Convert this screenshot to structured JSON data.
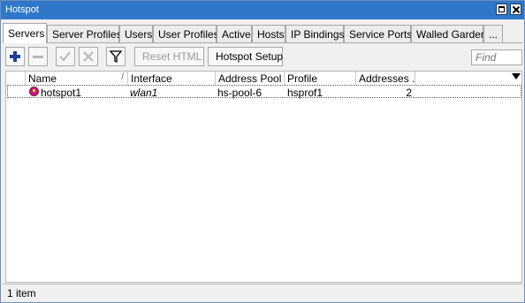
{
  "window": {
    "title": "Hotspot"
  },
  "tabs": [
    "Servers",
    "Server Profiles",
    "Users",
    "User Profiles",
    "Active",
    "Hosts",
    "IP Bindings",
    "Service Ports",
    "Walled Garden",
    "..."
  ],
  "toolbar": {
    "reset_html": "Reset HTML",
    "hotspot_setup": "Hotspot Setup",
    "find_placeholder": "Find"
  },
  "table": {
    "columns": [
      "Name",
      "Interface",
      "Address Pool",
      "Profile",
      "Addresses ..."
    ],
    "rows": [
      {
        "name": "hotspot1",
        "interface": "wlan1",
        "address_pool": "hs-pool-6",
        "profile": "hsprof1",
        "addresses": "2"
      }
    ]
  },
  "status": {
    "items": "1 item"
  },
  "colors": {
    "titlebar": "#2f78c9",
    "add_icon": "#1f3f9e",
    "status_icon": "#c81e7a"
  }
}
